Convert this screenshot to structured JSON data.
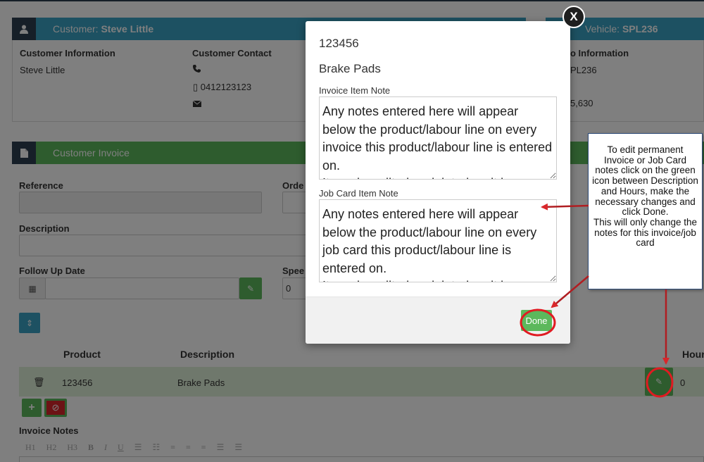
{
  "customer_panel": {
    "title_prefix": "Customer: ",
    "title_name": "Steve Little",
    "info_label": "Customer Information",
    "info_name": "Steve Little",
    "contact_label": "Customer Contact",
    "phone": "0412123123"
  },
  "vehicle_panel": {
    "title_prefix": "Vehicle: ",
    "title_rego": "SPL236",
    "info_label": "o Information",
    "rego": "PL236",
    "odometer": "5,630"
  },
  "invoice_panel": {
    "title": "Customer Invoice",
    "reference_label": "Reference",
    "order_label": "Orde",
    "description_label": "Description",
    "follow_up_label": "Follow Up Date",
    "speed_label": "Spee",
    "speed_value": "0"
  },
  "table": {
    "headers": {
      "product": "Product",
      "description": "Description",
      "hours": "Hour"
    },
    "rows": [
      {
        "product": "123456",
        "description": "Brake Pads",
        "hours": "0"
      }
    ]
  },
  "invoice_notes": {
    "label": "Invoice Notes",
    "toolbar": [
      "H1",
      "H2",
      "H3",
      "B",
      "I",
      "U",
      "☰",
      "☷",
      "≡",
      "≡",
      "≡",
      "☰",
      "☰"
    ]
  },
  "modal": {
    "code": "123456",
    "name": "Brake Pads",
    "invoice_note_label": "Invoice Item Note",
    "invoice_note_text": "Any notes entered here will appear below the product/labour line on every invoice this product/labour line is entered on.\nIt can be edited or deleted, or it is",
    "job_card_note_label": "Job Card Item Note",
    "job_card_note_text": "Any notes entered here will appear below the product/labour line on every job card this product/labour line is entered on.\nIt can be edited or deleted, or it is",
    "done_label": "Done",
    "close_label": "X"
  },
  "callout": {
    "text": "To edit permanent Invoice or Job Card notes click on the green icon between Description and Hours, make the necessary changes and click Done.\nThis will only change the notes for this invoice/job card"
  },
  "colors": {
    "header_blue": "#3ba2c4",
    "header_green": "#5cb85c",
    "dark_icon_box": "#2c3e50",
    "annotation_red": "#d9262a"
  }
}
